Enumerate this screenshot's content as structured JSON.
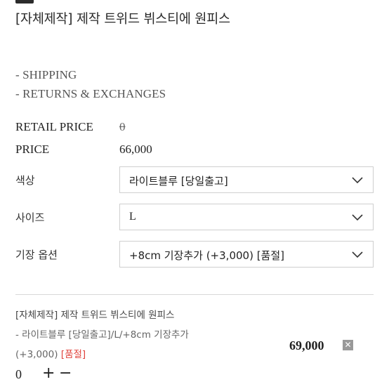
{
  "product": {
    "title": "[자체제작] 제작 트위드 뷔스티에 원피스"
  },
  "info_links": [
    "- SHIPPING",
    "- RETURNS & EXCHANGES"
  ],
  "prices": {
    "retail_label": "RETAIL PRICE",
    "retail_value": "0",
    "price_label": "PRICE",
    "price_value": "66,000"
  },
  "options": {
    "color": {
      "label": "색상",
      "selected": "라이트블루 [당일출고]"
    },
    "size": {
      "label": "사이즈",
      "selected": "L"
    },
    "length": {
      "label": "기장 옵션",
      "selected": "+8cm 기장추가 (+3,000) [품절]"
    }
  },
  "cart": {
    "item_title": "[자체제작] 제작 트위드 뷔스티에 원피스",
    "item_options": "- 라이트블루 [당일출고]/L/+8cm 기장추가",
    "item_extra": "(+3,000)",
    "item_soldout": "[품절]",
    "item_price": "69,000",
    "remove_symbol": "✕",
    "quantity": "0",
    "plus_symbol": "+",
    "minus_symbol": "−"
  },
  "colors": {
    "soldout": "#e0433c"
  }
}
